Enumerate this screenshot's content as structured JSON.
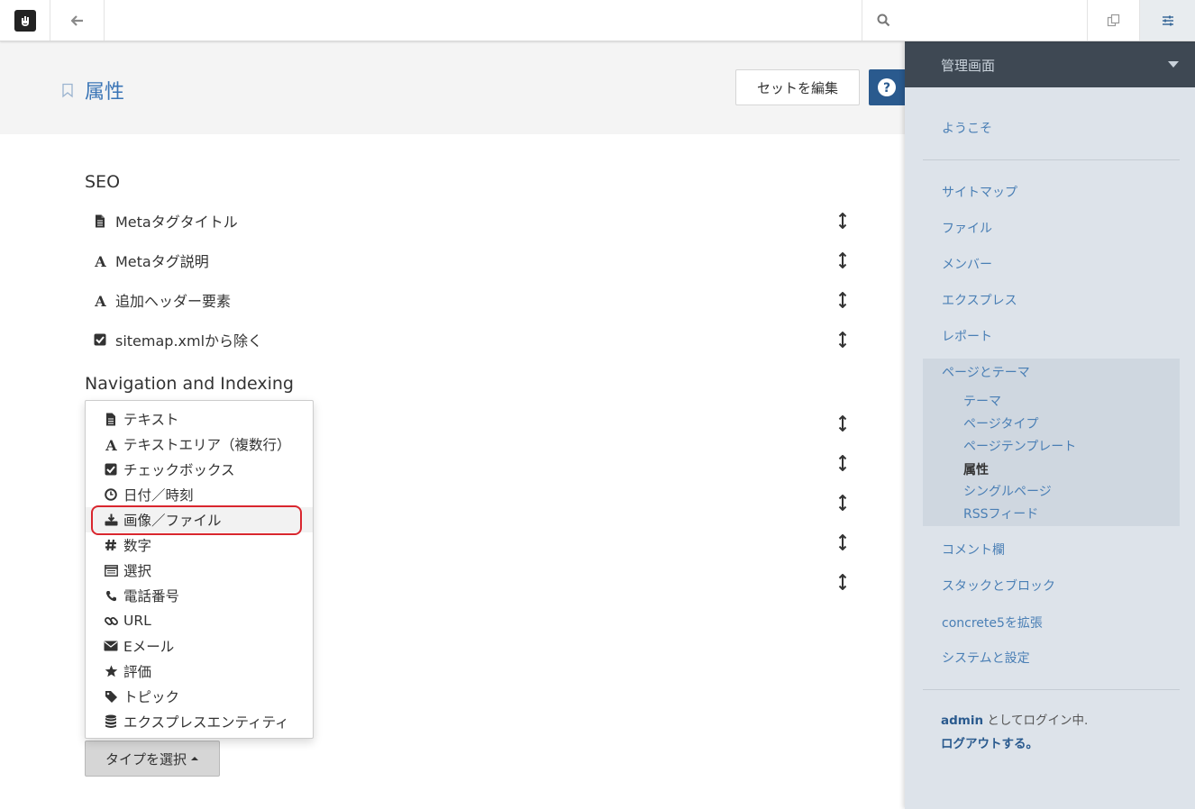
{
  "toolbar": {
    "logo_icon": "concrete5-logo-icon",
    "back_icon": "arrow-left-icon",
    "search_icon": "search-icon",
    "search_placeholder": "",
    "pages_icon": "copy-icon",
    "settings_icon": "sliders-icon"
  },
  "header": {
    "title": "属性",
    "edit_set_label": "セットを編集",
    "help_label": "?"
  },
  "sets": [
    {
      "name": "SEO",
      "attributes": [
        {
          "label": "Metaタグタイトル",
          "icon": "file-icon"
        },
        {
          "label": "Metaタグ説明",
          "icon": "font-icon"
        },
        {
          "label": "追加ヘッダー要素",
          "icon": "font-icon"
        },
        {
          "label": "sitemap.xmlから除く",
          "icon": "checkbox-icon"
        }
      ]
    },
    {
      "name": "Navigation and Indexing"
    }
  ],
  "type_menu": {
    "items": [
      {
        "label": "テキスト",
        "icon": "file-icon"
      },
      {
        "label": "テキストエリア（複数行）",
        "icon": "font-icon"
      },
      {
        "label": "チェックボックス",
        "icon": "checkbox-icon"
      },
      {
        "label": "日付／時刻",
        "icon": "clock-icon"
      },
      {
        "label": "画像／ファイル",
        "icon": "download-icon"
      },
      {
        "label": "数字",
        "icon": "hashtag-icon"
      },
      {
        "label": "選択",
        "icon": "list-icon"
      },
      {
        "label": "電話番号",
        "icon": "phone-icon"
      },
      {
        "label": "URL",
        "icon": "link-icon"
      },
      {
        "label": "Eメール",
        "icon": "envelope-icon"
      },
      {
        "label": "評価",
        "icon": "star-icon"
      },
      {
        "label": "トピック",
        "icon": "tag-icon"
      },
      {
        "label": "エクスプレスエンティティ",
        "icon": "database-icon"
      }
    ],
    "selected_index": 4,
    "button_label": "タイプを選択"
  },
  "panel": {
    "title": "管理画面",
    "welcome": "ようこそ",
    "items": [
      "サイトマップ",
      "ファイル",
      "メンバー",
      "エクスプレス",
      "レポート"
    ],
    "group": {
      "label": "ページとテーマ",
      "children": [
        "テーマ",
        "ページタイプ",
        "ページテンプレート",
        "属性",
        "シングルページ",
        "RSSフィード"
      ],
      "current_index": 3
    },
    "items_after": [
      "コメント欄",
      "スタックとブロック",
      "concrete5を拡張",
      "システムと設定"
    ],
    "login_user": "admin",
    "login_suffix": " としてログイン中.",
    "logout_label": "ログアウトする。"
  },
  "colors": {
    "accent": "#3a75b6",
    "help_button": "#2a5a8e",
    "highlight": "#d9262e",
    "panel_bg": "#dde3ea",
    "panel_header": "#3e4853"
  }
}
